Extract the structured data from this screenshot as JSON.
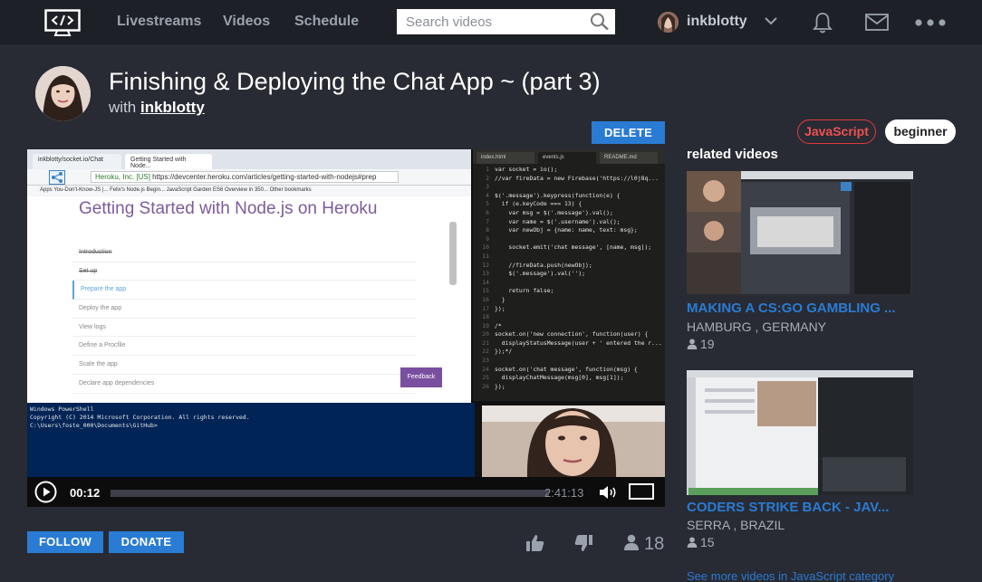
{
  "nav": {
    "links": [
      "Livestreams",
      "Videos",
      "Schedule"
    ],
    "search_placeholder": "Search videos",
    "username": "inkblotty"
  },
  "stream": {
    "title": "Finishing & Deploying the Chat App ~ (part 3)",
    "with_prefix": "with",
    "streamer": "inkblotty",
    "delete_label": "DELETE",
    "tags": [
      "JavaScript",
      "beginner"
    ]
  },
  "player": {
    "current_time": "00:12",
    "duration": "2:41:13",
    "screen": {
      "browser_tabs": [
        "inkblotty/socket.io/Chat",
        "Getting Started with Node..."
      ],
      "url": "https://devcenter.heroku.com/articles/getting-started-with-nodejs#prep",
      "url_owner": "Heroku, Inc. [US]",
      "bookmarks": "Apps  You-Don't-Know-JS |...  Felix's Node.js Begin...  JavaScript Garden  ES6 Overview in 350...  Other bookmarks",
      "page_heading": "Getting Started with Node.js on Heroku",
      "toc": [
        "Introduction",
        "Set up",
        "Prepare the app",
        "Deploy the app",
        "View logs",
        "Define a Procfile",
        "Scale the app",
        "Declare app dependencies"
      ],
      "feedback": "Feedback",
      "editor_tabs": [
        "index.html",
        "events.js",
        "README.md"
      ],
      "code_lines": [
        [
          "1",
          "var socket = io();"
        ],
        [
          "2",
          "//var fireData = new Firebase('https://l0j8q..."
        ],
        [
          "3",
          ""
        ],
        [
          "4",
          "$('.message').keypress(function(e) {"
        ],
        [
          "5",
          "  if (e.keyCode === 13) {"
        ],
        [
          "6",
          "    var msg = $('.message').val();"
        ],
        [
          "7",
          "    var name = $('.username').val();"
        ],
        [
          "8",
          "    var newObj = {name: name, text: msg};"
        ],
        [
          "9",
          ""
        ],
        [
          "10",
          "    socket.emit('chat message', [name, msg]);"
        ],
        [
          "11",
          ""
        ],
        [
          "12",
          "    //fireData.push(newObj);"
        ],
        [
          "13",
          "    $('.message').val('');"
        ],
        [
          "14",
          ""
        ],
        [
          "15",
          "    return false;"
        ],
        [
          "16",
          "  }"
        ],
        [
          "17",
          "});"
        ],
        [
          "18",
          ""
        ],
        [
          "19",
          "/*"
        ],
        [
          "20",
          "socket.on('new connection', function(user) {"
        ],
        [
          "21",
          "  displayStatusMessage(user + ' entered the r..."
        ],
        [
          "22",
          "});*/"
        ],
        [
          "23",
          ""
        ],
        [
          "24",
          "socket.on('chat message', function(msg) {"
        ],
        [
          "25",
          "  displayChatMessage(msg[0], msg[1]);"
        ],
        [
          "26",
          "});"
        ]
      ],
      "console_lines": [
        "Windows PowerShell",
        "Copyright (C) 2014 Microsoft Corporation. All rights reserved.",
        "",
        "C:\\Users\\foste_000\\Documents\\GitHub>"
      ]
    }
  },
  "actions": {
    "follow": "FOLLOW",
    "donate": "DONATE",
    "viewer_count": "18"
  },
  "sidebar": {
    "heading": "related videos",
    "videos": [
      {
        "title": "MAKING A CS:GO GAMBLING ...",
        "location": "HAMBURG , GERMANY",
        "views": "19"
      },
      {
        "title": "CODERS STRIKE BACK - JAV...",
        "location": "SERRA , BRAZIL",
        "views": "15"
      }
    ],
    "see_more": "See more videos in JavaScript category"
  },
  "colors": {
    "accent": "#2a7bd3",
    "nav_bg": "#1d2026",
    "page_bg": "#282b33",
    "tag_js": "#e03a3a"
  }
}
